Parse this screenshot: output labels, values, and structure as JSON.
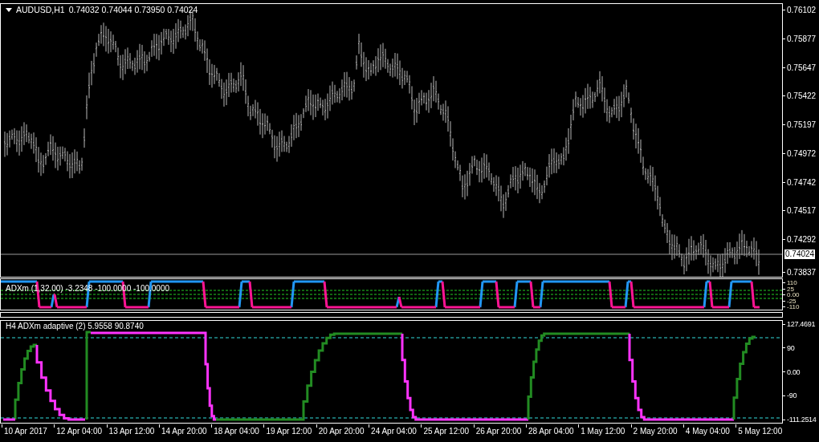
{
  "main_chart": {
    "symbol": "AUDUSD,H1",
    "ohlc": "0.74032 0.74044 0.73950 0.74024",
    "price_axis": [
      "0.76102",
      "0.75877",
      "0.75647",
      "0.75422",
      "0.75197",
      "0.74972",
      "0.74742",
      "0.74517",
      "0.74292",
      "0.73837"
    ],
    "current_price": "0.74024"
  },
  "adxm_pane": {
    "legend": "ADXm (1,32.00) -3.2348 -100.0000 -100.0000",
    "axis": [
      "110",
      "25",
      "0.00",
      "-25",
      "-110"
    ]
  },
  "adaptive_pane": {
    "legend": "H4 ADXm adaptive (2) 5.9558 90.8740",
    "axis": [
      "127.4691",
      "90",
      "0.00",
      "-90",
      "-111.2514"
    ]
  },
  "time_axis": [
    "10 Apr 2017",
    "12 Apr 04:00",
    "13 Apr 12:00",
    "14 Apr 20:00",
    "18 Apr 04:00",
    "19 Apr 12:00",
    "20 Apr 20:00",
    "24 Apr 04:00",
    "25 Apr 12:00",
    "26 Apr 20:00",
    "28 Apr 04:00",
    "1 May 12:00",
    "2 May 20:00",
    "4 May 04:00",
    "5 May 12:00"
  ]
}
